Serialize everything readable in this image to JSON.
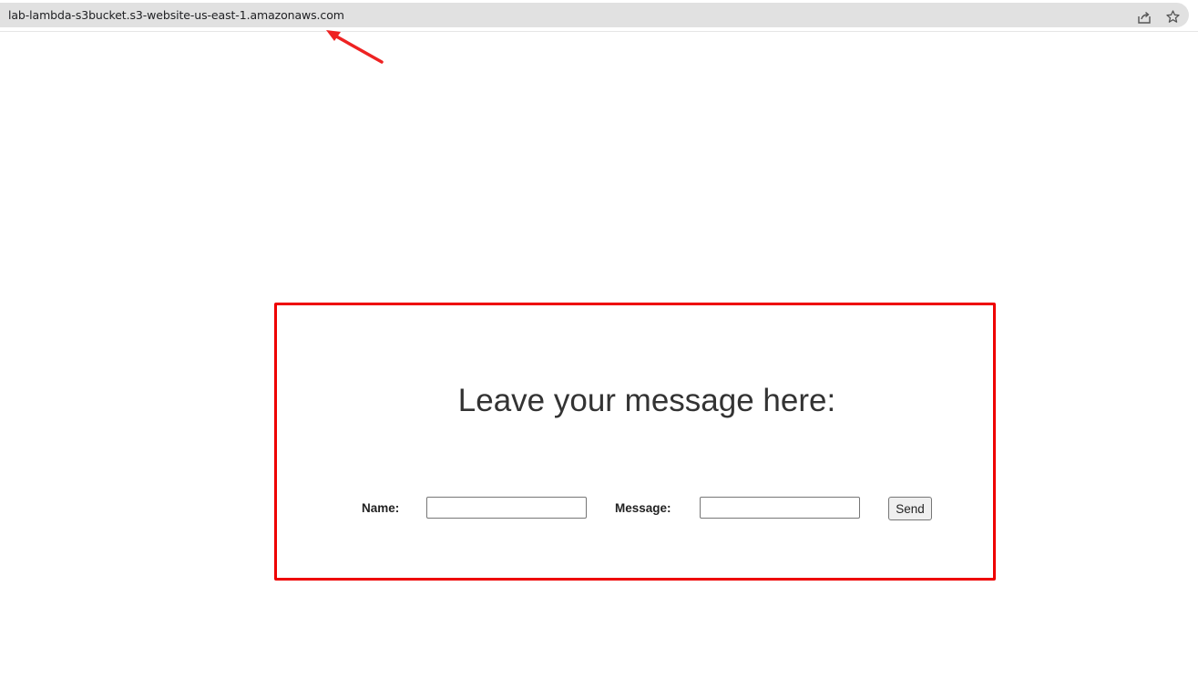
{
  "browser": {
    "url": "lab-lambda-s3bucket.s3-website-us-east-1.amazonaws.com",
    "icons": [
      "share-icon",
      "star-icon"
    ]
  },
  "annotations": {
    "arrow_color": "#ee2222",
    "box_color": "#ee0000"
  },
  "form": {
    "heading": "Leave your message here:",
    "name_label": "Name:",
    "name_value": "",
    "message_label": "Message:",
    "message_value": "",
    "send_label": "Send"
  }
}
